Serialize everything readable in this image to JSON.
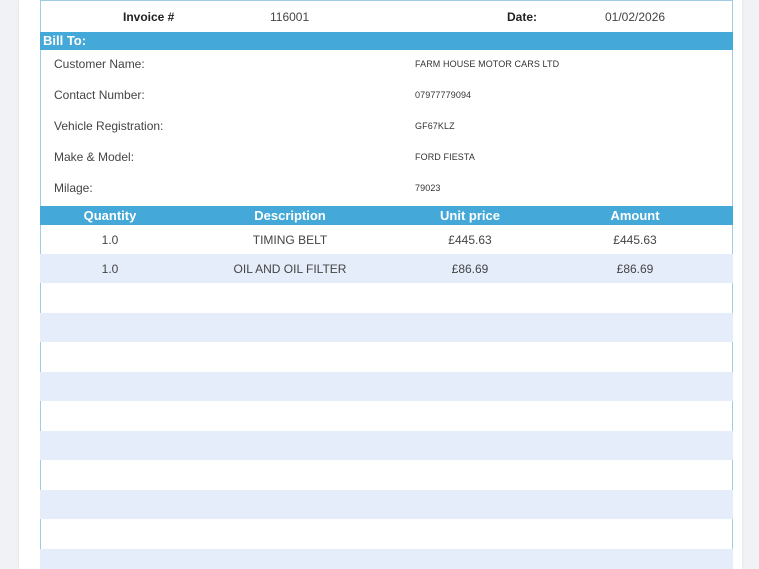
{
  "invoice": {
    "invoice_label": "Invoice #",
    "invoice_number": "116001",
    "date_label": "Date:",
    "date_value": "01/02/2026"
  },
  "bill_to": {
    "title": "Bill To:",
    "fields": [
      {
        "label": "Customer Name:",
        "value": "FARM HOUSE MOTOR CARS LTD"
      },
      {
        "label": "Contact Number:",
        "value": "07977779094"
      },
      {
        "label": "Vehicle Registration:",
        "value": "GF67KLZ"
      },
      {
        "label": "Make & Model:",
        "value": "FORD FIESTA"
      },
      {
        "label": "Milage:",
        "value": "79023"
      }
    ]
  },
  "items": {
    "headers": [
      "Quantity",
      "Description",
      "Unit price",
      "Amount"
    ],
    "rows": [
      {
        "quantity": "1.0",
        "description": "TIMING BELT",
        "unit_price": "£445.63",
        "amount": "£445.63"
      },
      {
        "quantity": "1.0",
        "description": "OIL AND OIL FILTER",
        "unit_price": "£86.69",
        "amount": "£86.69"
      }
    ]
  },
  "colors": {
    "header_bar": "#44a8d8",
    "row_shade": "#e6edfa"
  }
}
